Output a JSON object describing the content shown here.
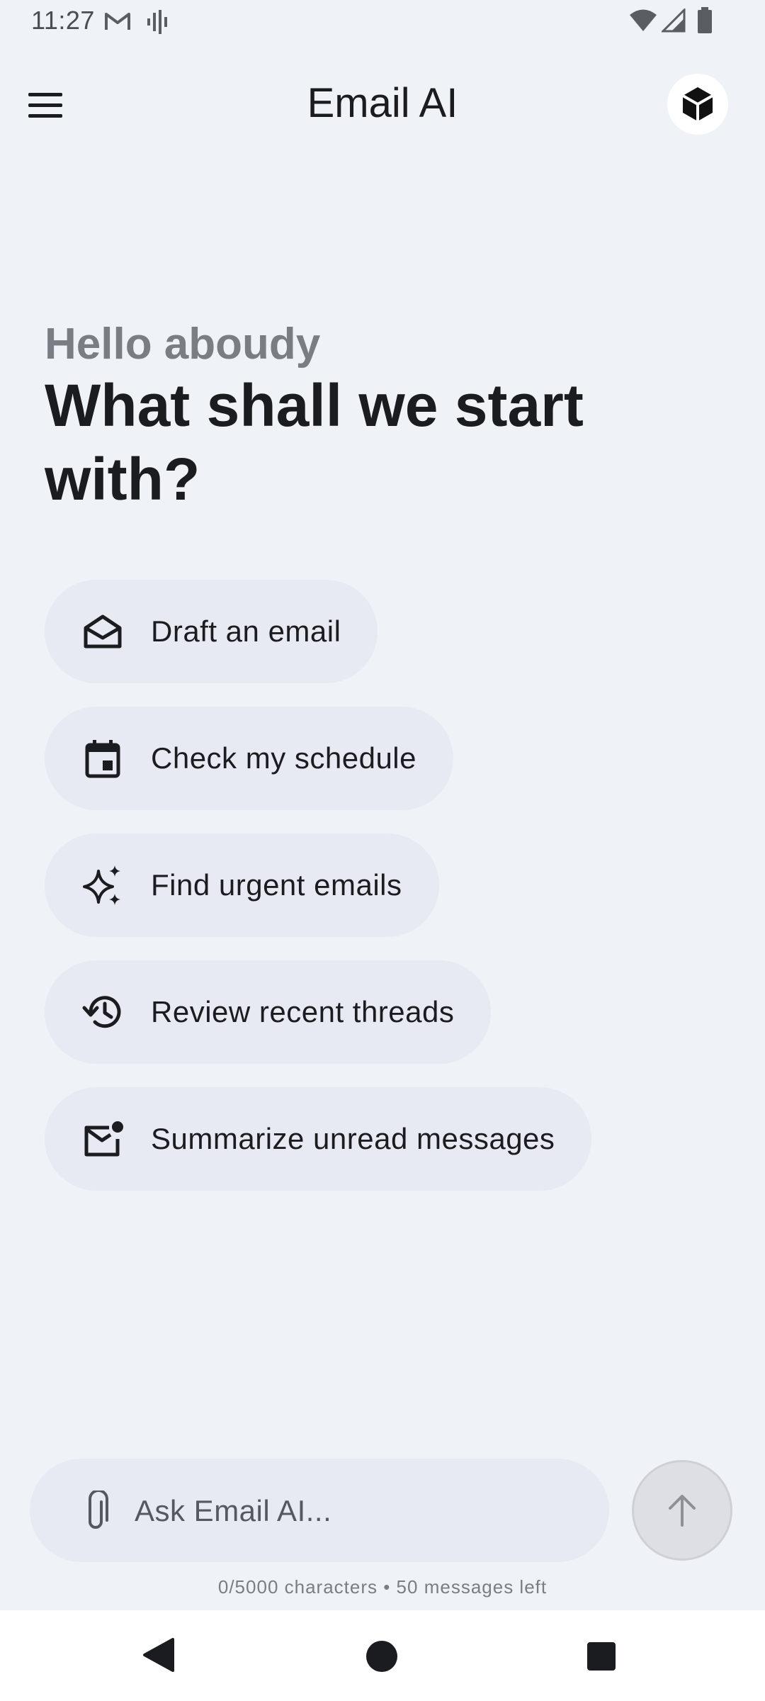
{
  "status_bar": {
    "time": "11:27",
    "icons": [
      "gmail-icon",
      "voice-icon",
      "wifi-icon",
      "signal-icon",
      "battery-icon"
    ]
  },
  "app_bar": {
    "title": "Email AI",
    "menu_icon": "menu-icon",
    "account_icon": "cube-icon"
  },
  "greeting": {
    "hello": "Hello aboudy",
    "headline": "What shall we start with?"
  },
  "suggestions": [
    {
      "label": "Draft an email",
      "icon": "envelope-open-icon"
    },
    {
      "label": "Check my schedule",
      "icon": "calendar-icon"
    },
    {
      "label": "Find urgent emails",
      "icon": "sparkle-icon"
    },
    {
      "label": "Review recent threads",
      "icon": "history-icon"
    },
    {
      "label": "Summarize unread messages",
      "icon": "mail-unread-icon"
    }
  ],
  "composer": {
    "placeholder": "Ask Email AI...",
    "value": "",
    "attach_icon": "paperclip-icon",
    "send_icon": "arrow-up-icon",
    "counter": "0/5000 characters • 50 messages left"
  },
  "nav_bar": {
    "icons": [
      "back-icon",
      "home-icon",
      "recents-icon"
    ]
  },
  "colors": {
    "background": "#eff2f7",
    "chip": "#e7eaf2",
    "text": "#1b1c1f",
    "muted": "#7a7d83"
  }
}
